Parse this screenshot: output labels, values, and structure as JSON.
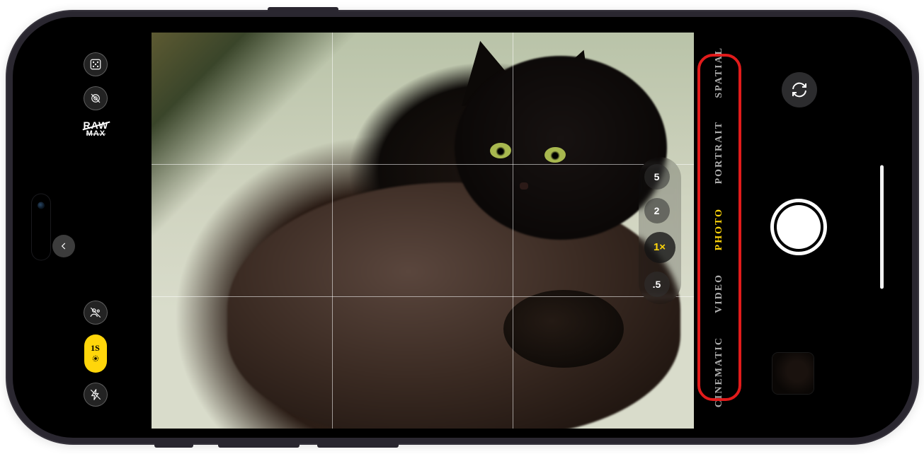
{
  "device": "iPhone",
  "app": "Camera",
  "mode_selector": {
    "modes": [
      "CINEMATIC",
      "VIDEO",
      "PHOTO",
      "PORTRAIT",
      "SPATIAL"
    ],
    "active": "PHOTO"
  },
  "zoom": {
    "levels": [
      "5",
      "2",
      "1×",
      ".5"
    ],
    "active": "1×"
  },
  "left_controls": {
    "photographic_styles_label": "photographic-styles",
    "night_mode_label": "night-mode-off",
    "raw_toggle": {
      "line1": "RAW",
      "line2": "MAX",
      "state": "off"
    },
    "flash_label": "flash-off",
    "live_photo_timer": "1S",
    "person_segmentation_label": "f-depth-off"
  },
  "right_controls": {
    "switch_camera_label": "switch-camera",
    "shutter_label": "shutter",
    "thumbnail_label": "last-photo-thumbnail"
  },
  "viewfinder": {
    "grid": true,
    "subject": "black cat lying on pale cushion"
  },
  "annotation": {
    "highlight_box": "camera-mode-selector"
  }
}
